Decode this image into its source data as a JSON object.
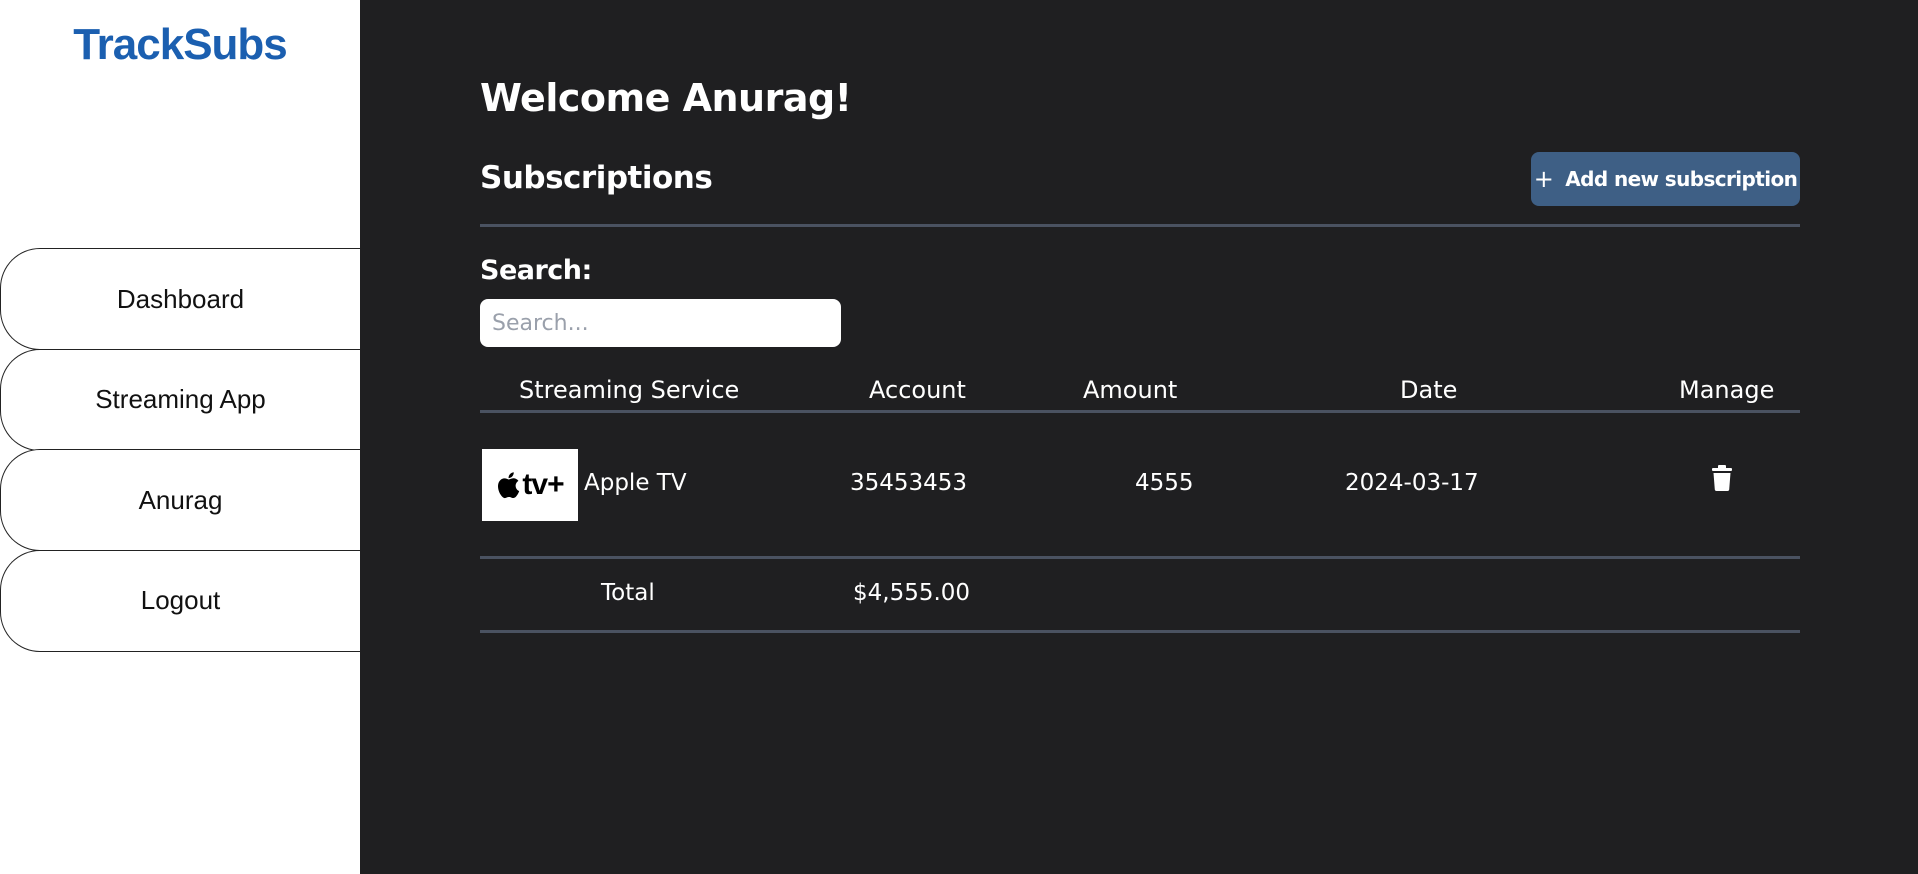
{
  "app": {
    "brand": "TrackSubs"
  },
  "sidebar": {
    "items": [
      {
        "label": "Dashboard"
      },
      {
        "label": "Streaming App"
      },
      {
        "label": "Anurag"
      },
      {
        "label": "Logout"
      }
    ]
  },
  "main": {
    "welcome": "Welcome Anurag!",
    "section_title": "Subscriptions",
    "add_button": {
      "icon": "plus-icon",
      "label": "Add new subscription"
    },
    "search": {
      "label": "Search:",
      "placeholder": "Search...",
      "value": ""
    },
    "table": {
      "headers": {
        "service": "Streaming Service",
        "account": "Account",
        "amount": "Amount",
        "date": "Date",
        "manage": "Manage"
      },
      "rows": [
        {
          "logo": {
            "icon": "apple-logo-icon",
            "text": "tv+"
          },
          "service": "Apple TV",
          "account": "35453453",
          "amount": "4555",
          "date": "2024-03-17",
          "manage_icon": "trash-icon"
        }
      ],
      "total": {
        "label": "Total",
        "value": "$4,555.00"
      }
    }
  },
  "colors": {
    "background": "#1f1f21",
    "sidebar": "#ffffff",
    "brand": "#1b5fb0",
    "accent_button": "#3e5f85",
    "divider": "#4a5261"
  }
}
